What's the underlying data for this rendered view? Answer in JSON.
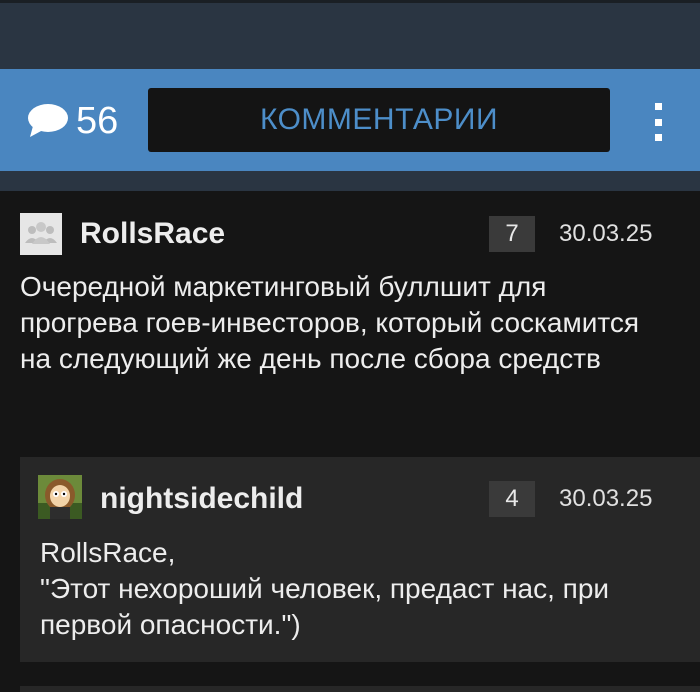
{
  "header": {
    "comment_count": "56",
    "comments_button": "КОММЕНТАРИИ",
    "accent_color": "#4a86c0",
    "icons": [
      "speech-bubble-icon",
      "kebab-menu-icon"
    ]
  },
  "comments": [
    {
      "username": "RollsRace",
      "score": "7",
      "date": "30.03.25",
      "text": "Очередной маркетинговый буллшит для прогрева гоев-инвесторов, который соскамится на следующий же день после сбора средств",
      "avatar": "default-users-avatar"
    }
  ],
  "replies": [
    {
      "username": "nightsidechild",
      "score": "4",
      "date": "30.03.25",
      "text": "RollsRace,\n\"Этот нехороший человек, предаст нас, при первой опасности.\")",
      "avatar": "cartoon-character-avatar"
    }
  ]
}
